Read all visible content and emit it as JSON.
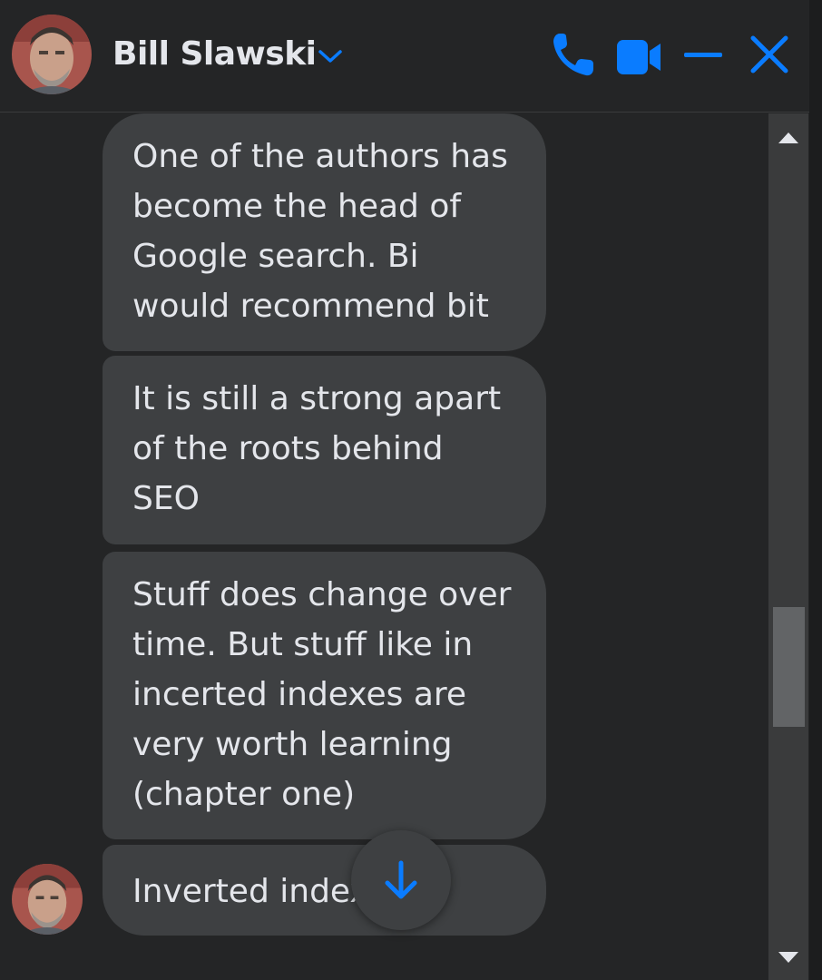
{
  "header": {
    "contact_name": "Bill Slawski",
    "avatar_icon": "avatar-bill-slawski",
    "chevron_icon": "chevron-down-icon",
    "actions": [
      {
        "name": "voice-call",
        "icon": "phone-icon"
      },
      {
        "name": "video-call",
        "icon": "video-camera-icon"
      },
      {
        "name": "minimize",
        "icon": "minimize-icon"
      },
      {
        "name": "close",
        "icon": "close-icon"
      }
    ]
  },
  "messages": [
    {
      "sender": "Bill Slawski",
      "text": "One of the authors has\nbecome the head of\nGoogle search.  Bi\nwould recommend bit"
    },
    {
      "sender": "Bill Slawski",
      "text": "It is still a strong apart\nof the roots behind\nSEO"
    },
    {
      "sender": "Bill Slawski",
      "text": "Stuff does change over\ntime.  But stuff like in\nincerted indexes are\nvery worth learning\n(chapter one)"
    },
    {
      "sender": "Bill Slawski",
      "text": "Inverted index"
    }
  ],
  "jump_to_latest": {
    "icon": "arrow-down-icon"
  },
  "colors": {
    "background": "#242526",
    "bubble": "#3e4042",
    "text": "#e4e6eb",
    "accent": "#0a7cff",
    "scrollbar_track": "#3a3b3c",
    "scrollbar_thumb": "#626466"
  }
}
